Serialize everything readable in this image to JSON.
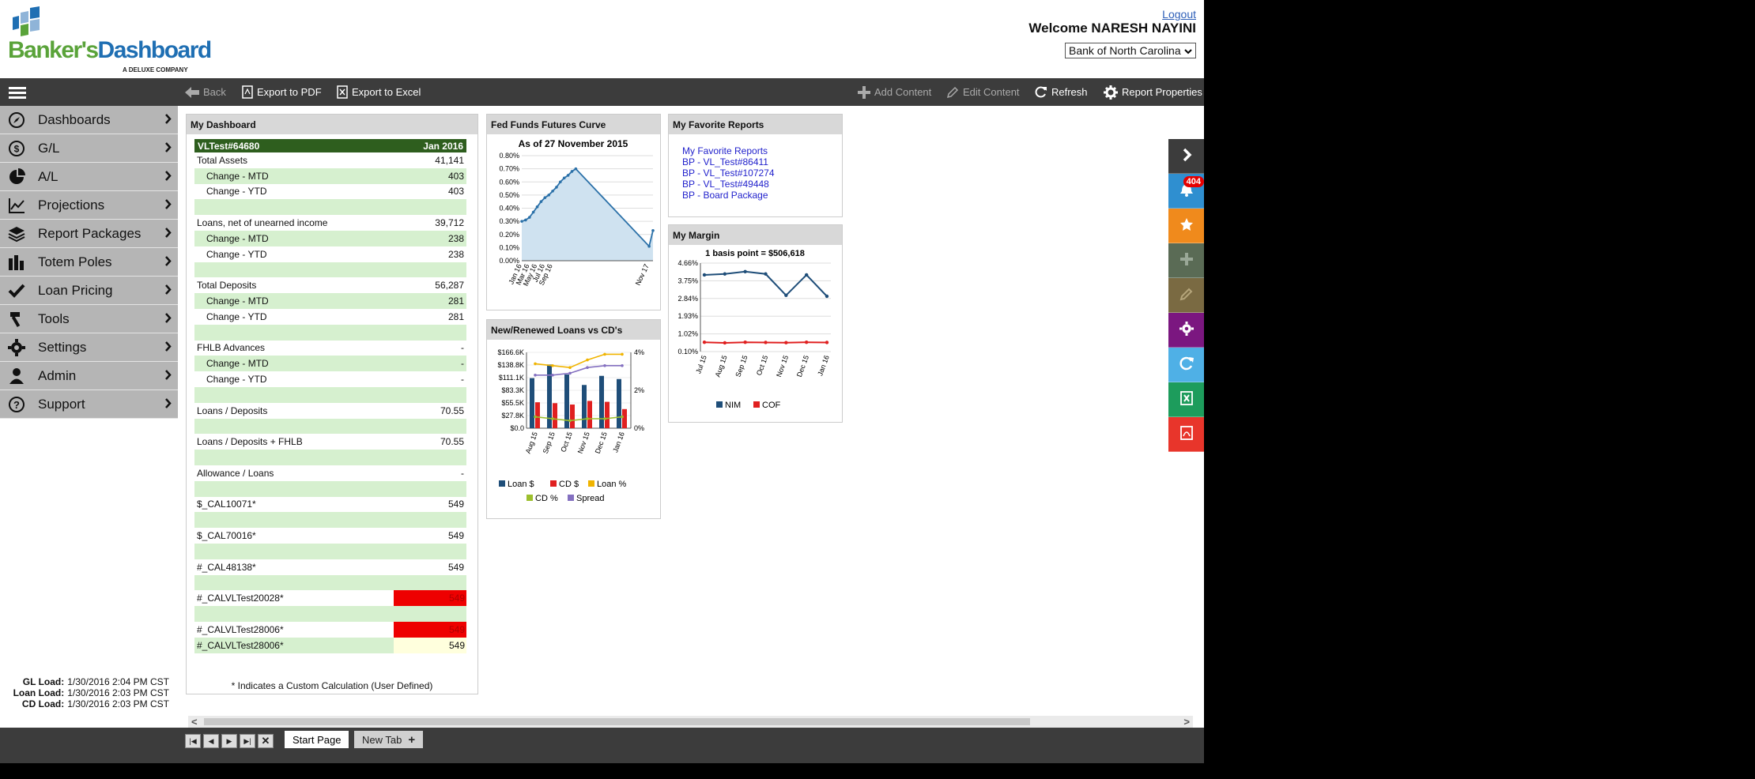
{
  "header": {
    "logo_brand_a": "Banker's",
    "logo_brand_b": "Dashboard",
    "logo_tag": "A DELUXE COMPANY",
    "logout": "Logout",
    "welcome": "Welcome  NARESH NAYINI",
    "bank_selected": "Bank of North Carolina"
  },
  "toolbar": {
    "back": "Back",
    "export_pdf": "Export to PDF",
    "export_excel": "Export to Excel",
    "add_content": "Add Content",
    "edit_content": "Edit Content",
    "refresh": "Refresh",
    "report_properties": "Report Properties"
  },
  "sidebar": {
    "items": [
      {
        "label": "Dashboards",
        "icon": "compass-icon"
      },
      {
        "label": "G/L",
        "icon": "dollar-icon"
      },
      {
        "label": "A/L",
        "icon": "pie-icon"
      },
      {
        "label": "Projections",
        "icon": "line-chart-icon"
      },
      {
        "label": "Report Packages",
        "icon": "layers-icon"
      },
      {
        "label": "Totem Poles",
        "icon": "bars-icon"
      },
      {
        "label": "Loan Pricing",
        "icon": "check-icon"
      },
      {
        "label": "Tools",
        "icon": "hammer-icon"
      },
      {
        "label": "Settings",
        "icon": "gear-icon"
      },
      {
        "label": "Admin",
        "icon": "user-icon"
      },
      {
        "label": "Support",
        "icon": "help-icon"
      }
    ],
    "loads": [
      {
        "label": "GL Load:",
        "value": "1/30/2016 2:04 PM CST"
      },
      {
        "label": "Loan Load:",
        "value": "1/30/2016 2:03 PM CST"
      },
      {
        "label": "CD Load:",
        "value": "1/30/2016 2:03 PM CST"
      }
    ]
  },
  "my_dashboard": {
    "title": "My Dashboard",
    "head_left": "VLTest#64680",
    "head_right": "Jan 2016",
    "rows": [
      {
        "label": "Total Assets",
        "value": "41,141",
        "style": "plain"
      },
      {
        "label": "Change - MTD",
        "value": "403",
        "style": "green-ind"
      },
      {
        "label": "Change - YTD",
        "value": "403",
        "style": "plain-ind"
      },
      {
        "label": "",
        "value": "",
        "style": "green"
      },
      {
        "label": "Loans, net of unearned income",
        "value": "39,712",
        "style": "plain"
      },
      {
        "label": "Change - MTD",
        "value": "238",
        "style": "green-ind"
      },
      {
        "label": "Change - YTD",
        "value": "238",
        "style": "plain-ind"
      },
      {
        "label": "",
        "value": "",
        "style": "green"
      },
      {
        "label": "Total Deposits",
        "value": "56,287",
        "style": "plain"
      },
      {
        "label": "Change - MTD",
        "value": "281",
        "style": "green-ind"
      },
      {
        "label": "Change - YTD",
        "value": "281",
        "style": "plain-ind"
      },
      {
        "label": "",
        "value": "",
        "style": "green"
      },
      {
        "label": "FHLB Advances",
        "value": "-",
        "style": "plain"
      },
      {
        "label": "Change - MTD",
        "value": "-",
        "style": "green-ind"
      },
      {
        "label": "Change - YTD",
        "value": "-",
        "style": "plain-ind"
      },
      {
        "label": "",
        "value": "",
        "style": "green"
      },
      {
        "label": "Loans / Deposits",
        "value": "70.55",
        "style": "plain"
      },
      {
        "label": "",
        "value": "",
        "style": "green"
      },
      {
        "label": "Loans / Deposits + FHLB",
        "value": "70.55",
        "style": "plain"
      },
      {
        "label": "",
        "value": "",
        "style": "green"
      },
      {
        "label": "Allowance / Loans",
        "value": "-",
        "style": "plain"
      },
      {
        "label": "",
        "value": "",
        "style": "green"
      },
      {
        "label": "$_CAL10071*",
        "value": "549",
        "style": "plain"
      },
      {
        "label": "",
        "value": "",
        "style": "green"
      },
      {
        "label": "$_CAL70016*",
        "value": "549",
        "style": "plain"
      },
      {
        "label": "",
        "value": "",
        "style": "green"
      },
      {
        "label": "#_CAL48138*",
        "value": "549",
        "style": "plain"
      },
      {
        "label": "",
        "value": "",
        "style": "green"
      },
      {
        "label": "#_CALVLTest20028*",
        "value": "549",
        "style": "red"
      },
      {
        "label": "",
        "value": "",
        "style": "green"
      },
      {
        "label": "#_CALVLTest28006*",
        "value": "549",
        "style": "red"
      },
      {
        "label": "#_CALVLTest28006*",
        "value": "549",
        "style": "green-yellow"
      }
    ],
    "footnote": "* Indicates a Custom Calculation (User Defined)"
  },
  "fed_funds": {
    "title": "Fed Funds Futures Curve",
    "chart_data": {
      "type": "area",
      "title": "As of 27 November 2015",
      "x_ticks": [
        "Jan 16",
        "Mar 16",
        "May 16",
        "Jul 16",
        "Sep 16",
        "Nov 17"
      ],
      "y_ticks": [
        "0.80%",
        "0.70%",
        "0.60%",
        "0.50%",
        "0.40%",
        "0.30%",
        "0.20%",
        "0.10%",
        "0.00%"
      ],
      "ylim": [
        0,
        0.8
      ],
      "points": [
        0.3,
        0.31,
        0.33,
        0.37,
        0.41,
        0.45,
        0.48,
        0.5,
        0.53,
        0.56,
        0.6,
        0.63,
        0.65,
        0.68,
        0.7,
        0.11,
        0.23
      ],
      "point_x": [
        0,
        1,
        2,
        3,
        4,
        5,
        6,
        7,
        8,
        9,
        10,
        11,
        12,
        13,
        14,
        33,
        34
      ],
      "color": "#2a70a8",
      "fill": "#cfe2f0"
    }
  },
  "new_loans": {
    "title": "New/Renewed Loans vs CD's",
    "chart_data": {
      "type": "bar",
      "categories": [
        "Aug 15",
        "Sep 15",
        "Oct 15",
        "Nov 15",
        "Dec 15",
        "Jan 16"
      ],
      "y_ticks_left": [
        "$166.6K",
        "$138.8K",
        "$111.1K",
        "$83.3K",
        "$55.5K",
        "$27.8K",
        "$0.0"
      ],
      "y_ticks_right": [
        "4%",
        "2%",
        "0%"
      ],
      "ylim_left": [
        0,
        166.6
      ],
      "ylim_right": [
        0,
        4
      ],
      "series": [
        {
          "name": "Loan $",
          "values": [
            110,
            140,
            118,
            95,
            115,
            108
          ],
          "color": "#1f4e79",
          "kind": "bar"
        },
        {
          "name": "CD $",
          "values": [
            57,
            55,
            52,
            60,
            58,
            42
          ],
          "color": "#e02020",
          "kind": "bar"
        },
        {
          "name": "Loan %",
          "values": [
            3.4,
            3.3,
            3.2,
            3.6,
            3.9,
            3.9
          ],
          "color": "#f0b400",
          "kind": "line"
        },
        {
          "name": "CD %",
          "values": [
            0.6,
            0.5,
            0.4,
            0.5,
            0.5,
            0.6
          ],
          "color": "#9cbf2e",
          "kind": "line"
        },
        {
          "name": "Spread",
          "values": [
            2.8,
            2.8,
            2.9,
            3.2,
            3.3,
            3.3
          ],
          "color": "#8470c0",
          "kind": "line"
        }
      ]
    }
  },
  "favorites": {
    "title": "My Favorite Reports",
    "links": [
      "My Favorite Reports",
      "BP - VL_Test#86411",
      "BP - VL_Test#107274",
      "BP - VL_Test#49448",
      "BP - Board Package"
    ]
  },
  "my_margin": {
    "title": "My Margin",
    "chart_data": {
      "type": "line",
      "title": "1 basis point = $506,618",
      "categories": [
        "Jul 15",
        "Aug 15",
        "Sep 15",
        "Oct 15",
        "Nov 15",
        "Dec 15",
        "Jan 16"
      ],
      "y_ticks": [
        "4.66%",
        "3.75%",
        "2.84%",
        "1.93%",
        "1.02%",
        "0.10%"
      ],
      "ylim": [
        0.1,
        4.66
      ],
      "series": [
        {
          "name": "NIM",
          "values": [
            4.05,
            4.1,
            4.22,
            4.1,
            3.0,
            4.05,
            2.95
          ],
          "color": "#1f4e79"
        },
        {
          "name": "COF",
          "values": [
            0.58,
            0.55,
            0.58,
            0.57,
            0.56,
            0.58,
            0.57
          ],
          "color": "#e02020"
        }
      ]
    }
  },
  "bottom": {
    "tabs": [
      {
        "label": "Start Page",
        "active": true
      },
      {
        "label": "New Tab",
        "active": false
      }
    ]
  },
  "quickbar": {
    "badge": "404",
    "colors": [
      "#3c3c3c",
      "#2f8fd0",
      "#f08a1c",
      "#5a6b55",
      "#7a6a42",
      "#7b1780",
      "#4fb0e6",
      "#1d9c5c",
      "#e8352b"
    ]
  }
}
